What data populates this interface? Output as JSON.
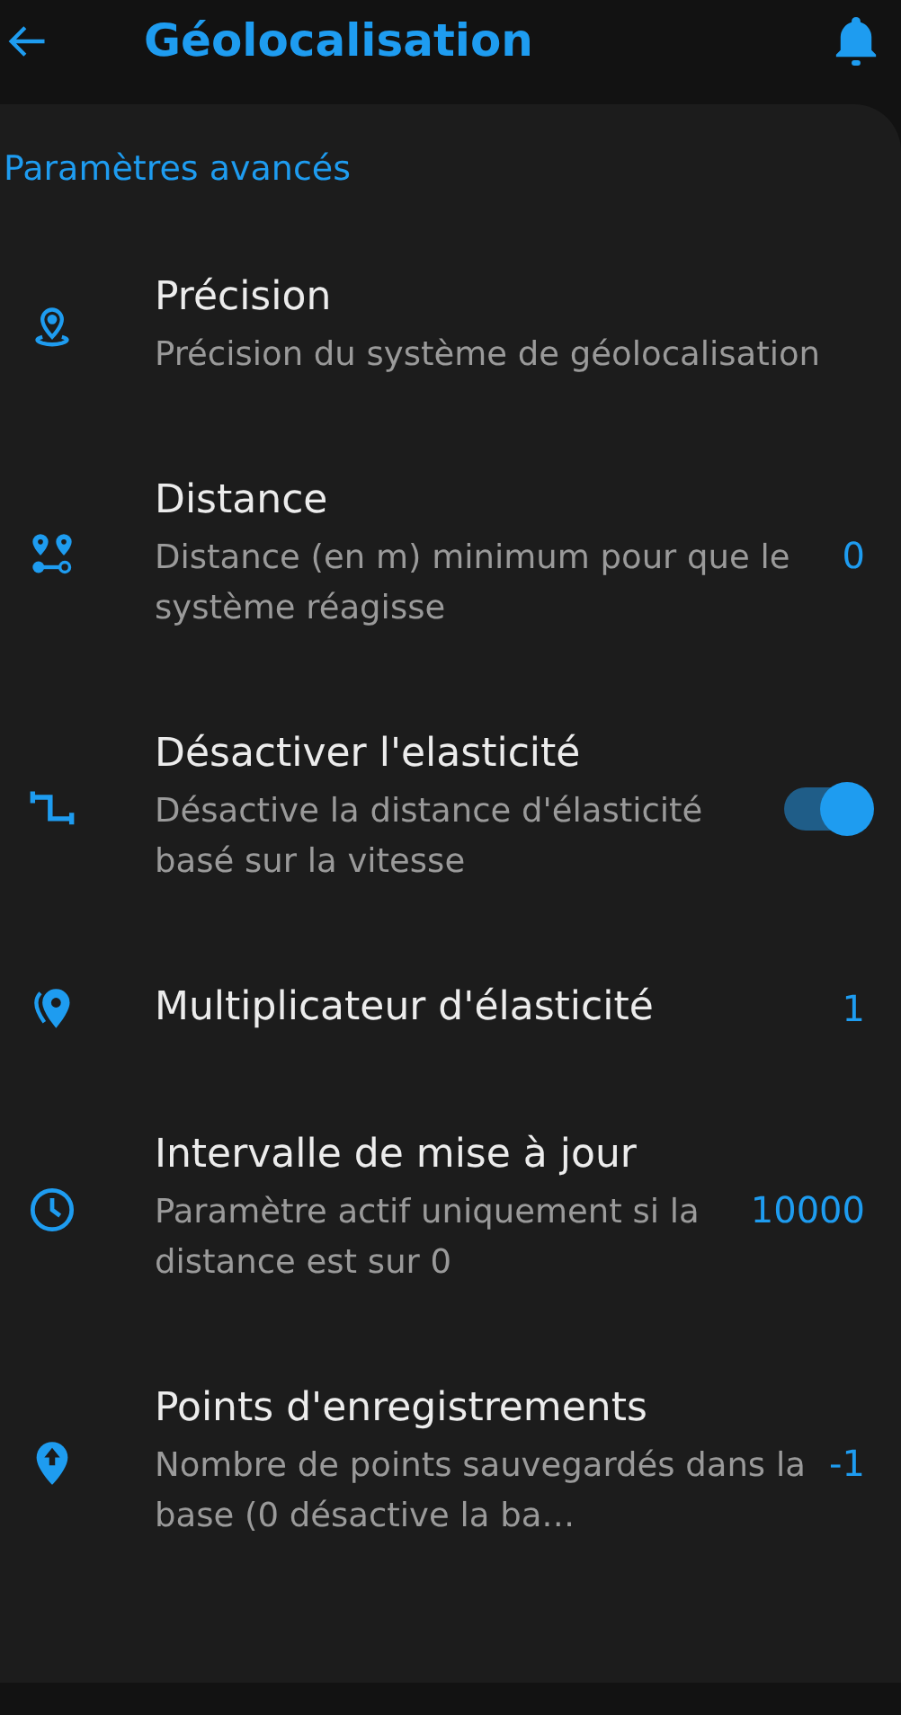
{
  "header": {
    "title": "Géolocalisation"
  },
  "section": {
    "title": "Paramètres avancés"
  },
  "settings": [
    {
      "kind": "plain",
      "title": "Précision",
      "subtitle": "Précision du système de géolocalisation"
    },
    {
      "kind": "value",
      "title": "Distance",
      "subtitle": "Distance (en m) minimum pour que le système réagisse",
      "value": "0"
    },
    {
      "kind": "switch",
      "title": "Désactiver l'elasticité",
      "subtitle": "Désactive la distance d'élasticité basé sur la vitesse",
      "on": true
    },
    {
      "kind": "value",
      "title": "Multiplicateur d'élasticité",
      "value": "1"
    },
    {
      "kind": "value",
      "title": "Intervalle de mise à jour",
      "subtitle": "Paramètre actif uniquement si la distance est sur 0",
      "value": "10000"
    },
    {
      "kind": "value",
      "title": "Points d'enregistrements",
      "subtitle": "Nombre de points sauvegardés dans la base (0 désactive la ba…",
      "value": "-1"
    }
  ]
}
